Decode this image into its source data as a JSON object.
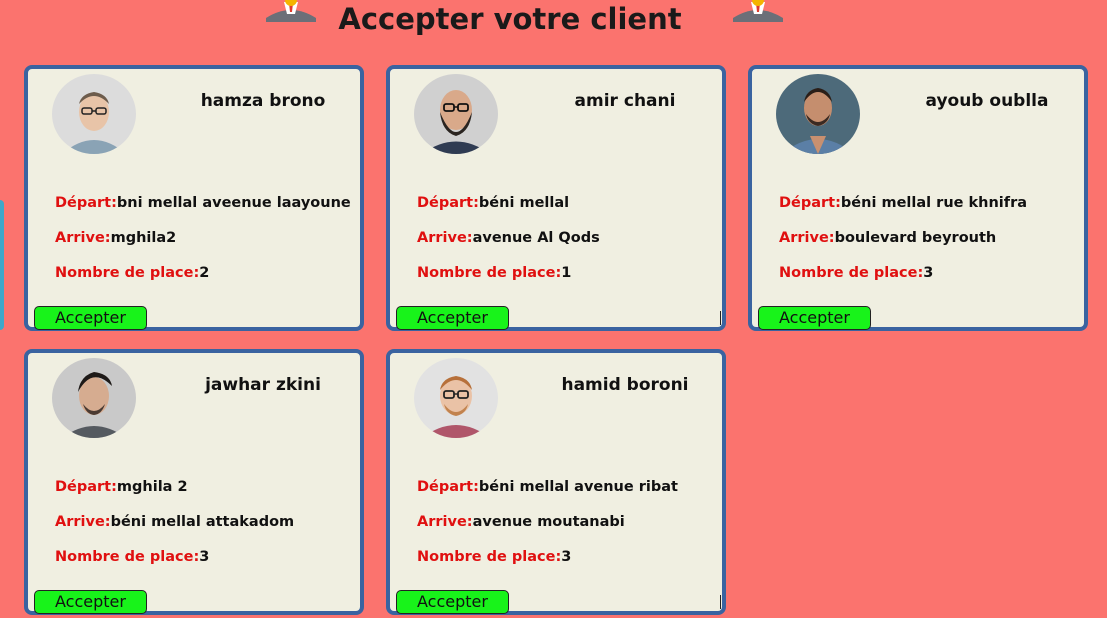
{
  "page": {
    "title": "Accepter votre client",
    "colors": {
      "background": "#fb736e",
      "card": "#f0efe1",
      "card_border": "#3a63a0",
      "label": "#e01010",
      "button": "#18f31a"
    }
  },
  "labels": {
    "depart": "Départ:",
    "arrive": "Arrive:",
    "places": "Nombre de place:",
    "accept": "Accepter"
  },
  "clients": [
    {
      "name": "hamza brono",
      "depart": "bni mellal aveenue laayoune",
      "arrive": "mghila2",
      "places": "2",
      "avatar": "man-glasses-light-shirt"
    },
    {
      "name": "amir chani",
      "depart": "béni mellal",
      "arrive": "avenue Al Qods",
      "places": "1",
      "avatar": "bearded-man-glasses"
    },
    {
      "name": "ayoub oublla",
      "depart": "béni mellal rue khnifra",
      "arrive": "boulevard beyrouth",
      "places": "3",
      "avatar": "man-denim-jacket"
    },
    {
      "name": "jawhar zkini",
      "depart": "mghila 2",
      "arrive": "béni mellal attakadom",
      "places": "3",
      "avatar": "man-dark-hair-portrait"
    },
    {
      "name": "hamid boroni",
      "depart": "béni mellal avenue ribat",
      "arrive": "avenue moutanabi",
      "places": "3",
      "avatar": "man-ginger-glasses"
    }
  ]
}
